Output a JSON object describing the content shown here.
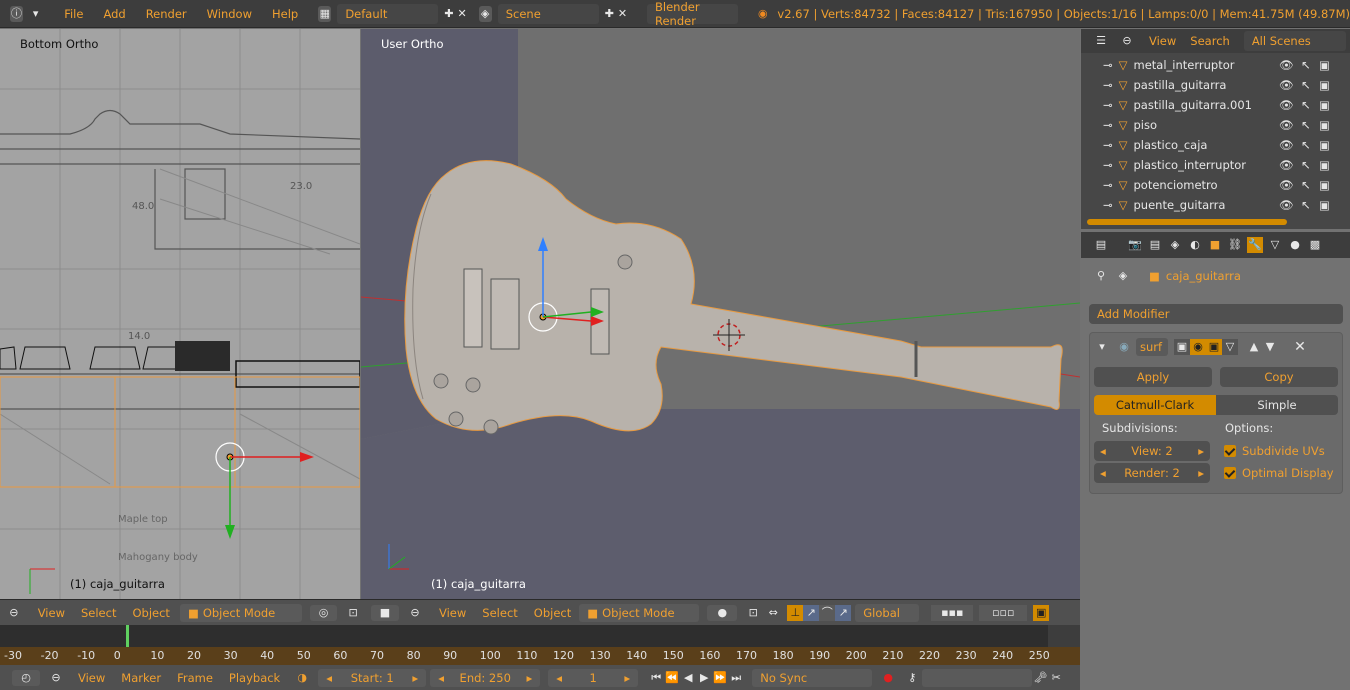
{
  "topbar": {
    "menus": [
      "File",
      "Add",
      "Render",
      "Window",
      "Help"
    ],
    "layout": "Default",
    "scene": "Scene",
    "engine": "Blender Render",
    "stats": "v2.67 | Verts:84732 | Faces:84127 | Tris:167950 | Objects:1/16 | Lamps:0/0 | Mem:41.75M (49.87M)"
  },
  "left_view": {
    "label": "Bottom Ortho",
    "object_label": "(1) caja_guitarra",
    "header": {
      "view": "View",
      "select": "Select",
      "object": "Object",
      "mode": "Object Mode"
    },
    "sketch_texts": [
      "23.0",
      "48.0",
      "14.0",
      "Maple top",
      "Mahogany body"
    ]
  },
  "main_view": {
    "label": "User Ortho",
    "object_label": "(1) caja_guitarra",
    "header": {
      "view": "View",
      "select": "Select",
      "object": "Object",
      "mode": "Object Mode",
      "orientation": "Global"
    }
  },
  "outliner": {
    "menus": [
      "View",
      "Search"
    ],
    "scope": "All Scenes",
    "items": [
      "metal_interruptor",
      "pastilla_guitarra",
      "pastilla_guitarra.001",
      "piso",
      "plastico_caja",
      "plastico_interruptor",
      "potenciometro",
      "puente_guitarra"
    ]
  },
  "properties": {
    "object": "caja_guitarra",
    "add_modifier": "Add Modifier",
    "modifier_name": "surf",
    "apply": "Apply",
    "copy": "Copy",
    "type_a": "Catmull-Clark",
    "type_b": "Simple",
    "subdivisions_label": "Subdivisions:",
    "options_label": "Options:",
    "view_field": "View: 2",
    "render_field": "Render: 2",
    "opt1": "Subdivide UVs",
    "opt2": "Optimal Display"
  },
  "timeline": {
    "ticks": [
      "-30",
      "-20",
      "-10",
      "0",
      "10",
      "20",
      "30",
      "40",
      "50",
      "60",
      "70",
      "80",
      "90",
      "100",
      "110",
      "120",
      "130",
      "140",
      "150",
      "160",
      "170",
      "180",
      "190",
      "200",
      "210",
      "220",
      "230",
      "240",
      "250"
    ],
    "menus": [
      "View",
      "Marker",
      "Frame",
      "Playback"
    ],
    "start": "Start: 1",
    "end": "End: 250",
    "current": "1",
    "sync": "No Sync"
  },
  "colors": {
    "accent": "#f0a030",
    "selected": "#d38b00",
    "panel": "#3d3d3d"
  }
}
